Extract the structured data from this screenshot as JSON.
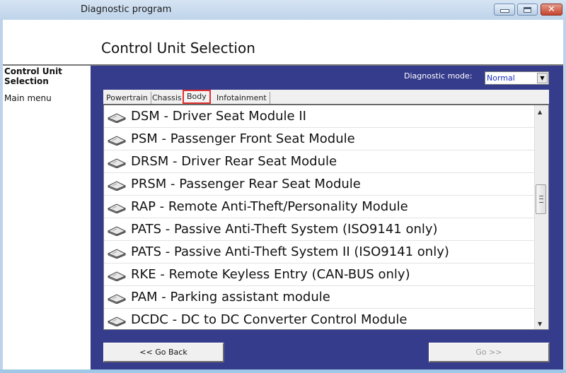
{
  "window": {
    "title": "Diagnostic program",
    "controls": {
      "minimize": "minimize-icon",
      "maximize": "maximize-icon",
      "close": "close-icon"
    }
  },
  "header": {
    "title": "Control Unit Selection"
  },
  "sidebar": {
    "current": "Control Unit Selection",
    "items": [
      {
        "label": "Main menu"
      }
    ]
  },
  "mode": {
    "label": "Diagnostic mode:",
    "value": "Normal"
  },
  "tabs": [
    {
      "label": "Powertrain",
      "active": false
    },
    {
      "label": "Chassis",
      "active": false
    },
    {
      "label": "Body",
      "active": true
    },
    {
      "label": "Infotainment",
      "active": false
    }
  ],
  "modules": [
    {
      "label": "DSM - Driver Seat Module II",
      "icon": "module-icon"
    },
    {
      "label": "PSM - Passenger Front Seat Module",
      "icon": "module-icon"
    },
    {
      "label": "DRSM - Driver Rear Seat Module",
      "icon": "module-icon"
    },
    {
      "label": "PRSM - Passenger Rear Seat Module",
      "icon": "module-icon"
    },
    {
      "label": "RAP - Remote Anti-Theft/Personality Module",
      "icon": "module-icon"
    },
    {
      "label": "PATS - Passive Anti-Theft System (ISO9141 only)",
      "icon": "module-icon"
    },
    {
      "label": "PATS - Passive Anti-Theft System II (ISO9141 only)",
      "icon": "module-icon"
    },
    {
      "label": "RKE - Remote Keyless Entry (CAN-BUS only)",
      "icon": "module-icon"
    },
    {
      "label": "PAM - Parking assistant module",
      "icon": "module-icon"
    },
    {
      "label": "DCDC - DC to DC Converter Control Module",
      "icon": "module-icon"
    }
  ],
  "buttons": {
    "back": "<< Go Back",
    "go": "Go >>"
  },
  "colors": {
    "panel_bg": "#363c8c",
    "tab_highlight": "#e0302f",
    "mode_value": "#1a2ec0",
    "go_disabled": "#9a9a9a"
  }
}
